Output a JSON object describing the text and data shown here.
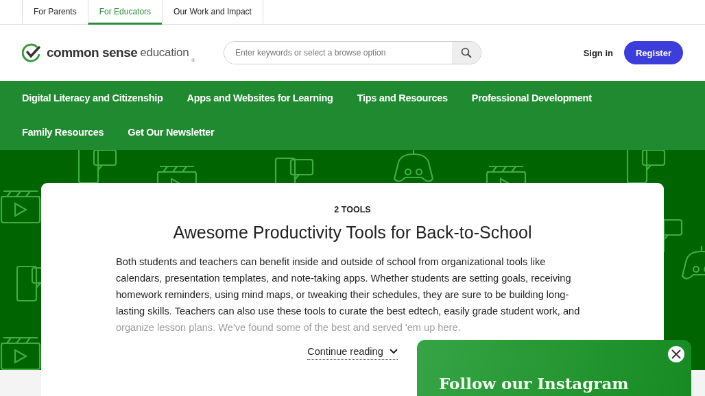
{
  "audience_tabs": [
    {
      "label": "For Parents",
      "selected": false
    },
    {
      "label": "For Educators",
      "selected": true
    },
    {
      "label": "Our Work and Impact",
      "selected": false
    }
  ],
  "logo": {
    "brand": "common sense",
    "product": "education",
    "mark": "®"
  },
  "search": {
    "placeholder": "Enter keywords or select a browse option"
  },
  "sign_in": "Sign in",
  "register": "Register",
  "main_nav": [
    "Digital Literacy and Citizenship",
    "Apps and Websites for Learning",
    "Tips and Resources",
    "Professional Development",
    "Family Resources",
    "Get Our Newsletter"
  ],
  "article": {
    "eyebrow": "2 TOOLS",
    "title": "Awesome Productivity Tools for Back-to-School",
    "body": "Both students and teachers can benefit inside and outside of school from organizational tools like calendars, presentation templates, and note-taking apps. Whether students are setting goals, receiving homework reminders, using mind maps, or tweaking their schedules, they are sure to be building long-lasting skills. Teachers can also use these tools to curate the best edtech, easily grade student work, and organize lesson plans. We've found some of the best and served 'em up here.",
    "continue": "Continue reading"
  },
  "popup": {
    "title": "Follow our Instagram"
  }
}
